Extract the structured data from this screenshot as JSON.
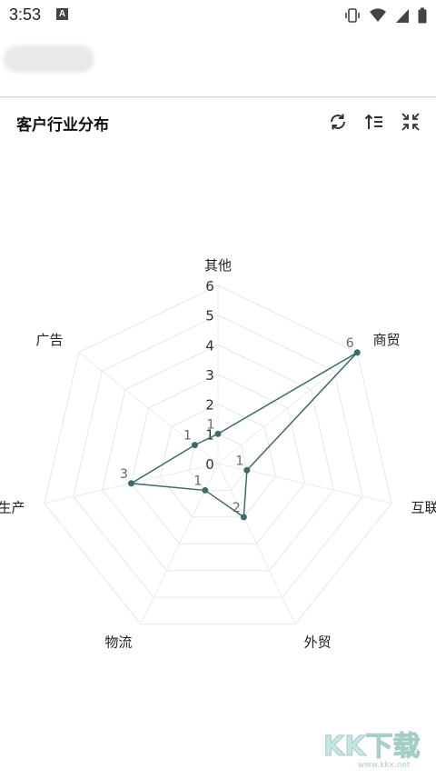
{
  "status_bar": {
    "time": "3:53",
    "notification_icon": "A",
    "icons": [
      "vibrate-icon",
      "wifi-icon",
      "signal-icon",
      "battery-icon"
    ]
  },
  "card": {
    "title": "客户行业分布",
    "tools": [
      "refresh-icon",
      "sort-icon",
      "collapse-icon"
    ]
  },
  "chart_data": {
    "type": "radar",
    "title": "客户行业分布",
    "indicators": [
      "其他",
      "商贸",
      "互联网",
      "外贸",
      "物流",
      "生产",
      "广告"
    ],
    "values": [
      1,
      6,
      1,
      2,
      1,
      3,
      1
    ],
    "radius_ticks": [
      "0",
      "1",
      "2",
      "3",
      "4",
      "5",
      "6"
    ],
    "max": 6,
    "grid": true,
    "series_color": "#3d6b6b"
  },
  "watermark": {
    "text": "KK下载",
    "url": "www.kkx.net"
  }
}
